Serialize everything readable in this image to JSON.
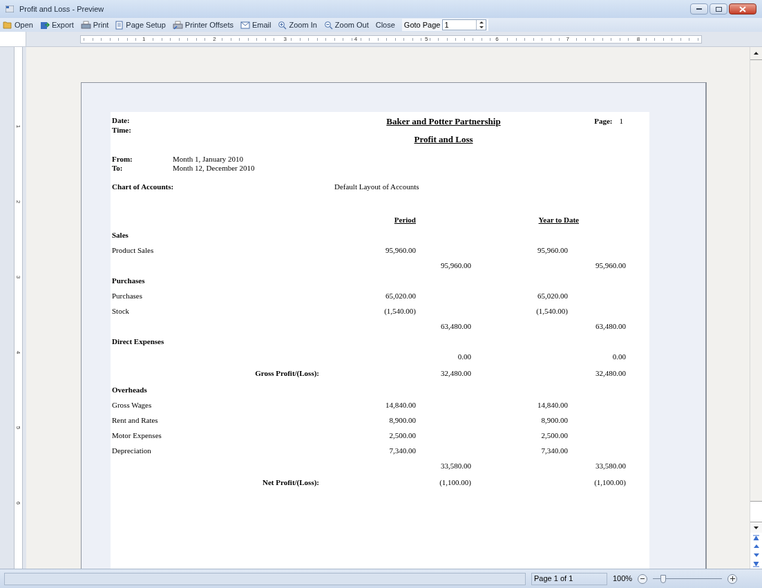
{
  "window": {
    "title": "Profit and Loss - Preview"
  },
  "toolbar": [
    {
      "kind": "open",
      "label": "Open"
    },
    {
      "kind": "export",
      "label": "Export"
    },
    {
      "kind": "print",
      "label": "Print"
    },
    {
      "kind": "page-setup",
      "label": "Page Setup"
    },
    {
      "kind": "offsets",
      "label": "Printer Offsets"
    },
    {
      "kind": "email",
      "label": "Email"
    },
    {
      "kind": "zoom-in",
      "label": "Zoom In"
    },
    {
      "kind": "zoom-out",
      "label": "Zoom Out"
    },
    {
      "kind": "plain",
      "label": "Close"
    }
  ],
  "goto_page": {
    "label": "Goto Page",
    "value": "1"
  },
  "ruler": {
    "horizontal": [
      "1",
      "2",
      "3",
      "4",
      "5",
      "6",
      "7",
      "8"
    ],
    "vertical": [
      "1",
      "2",
      "3",
      "4",
      "5",
      "6"
    ]
  },
  "report": {
    "date_label": "Date:",
    "time_label": "Time:",
    "page_label": "Page:",
    "page_number": "1",
    "company": "Baker and Potter Partnership",
    "title": "Profit and Loss",
    "from_label": "From:",
    "from_value": "Month 1, January 2010",
    "to_label": "To:",
    "to_value": "Month 12, December 2010",
    "chart_label": "Chart of Accounts:",
    "chart_value": "Default Layout of Accounts",
    "col_period": "Period",
    "col_ytd": "Year to Date",
    "rows": [
      {
        "kind": "section",
        "label": "Sales"
      },
      {
        "kind": "item",
        "label": "Product Sales",
        "period": "95,960.00",
        "ytd": "95,960.00"
      },
      {
        "kind": "subtotal",
        "period": "95,960.00",
        "ytd": "95,960.00"
      },
      {
        "kind": "section",
        "label": "Purchases"
      },
      {
        "kind": "item",
        "label": "Purchases",
        "period": "65,020.00",
        "ytd": "65,020.00"
      },
      {
        "kind": "item",
        "label": "Stock",
        "period": "(1,540.00)",
        "ytd": "(1,540.00)"
      },
      {
        "kind": "subtotal",
        "period": "63,480.00",
        "ytd": "63,480.00"
      },
      {
        "kind": "section",
        "label": "Direct Expenses"
      },
      {
        "kind": "subtotal",
        "period": "0.00",
        "ytd": "0.00"
      },
      {
        "kind": "total",
        "label": "Gross Profit/(Loss):",
        "period": "32,480.00",
        "ytd": "32,480.00"
      },
      {
        "kind": "section",
        "label": "Overheads"
      },
      {
        "kind": "item",
        "label": "Gross Wages",
        "period": "14,840.00",
        "ytd": "14,840.00"
      },
      {
        "kind": "item",
        "label": "Rent and Rates",
        "period": "8,900.00",
        "ytd": "8,900.00"
      },
      {
        "kind": "item",
        "label": "Motor Expenses",
        "period": "2,500.00",
        "ytd": "2,500.00"
      },
      {
        "kind": "item",
        "label": "Depreciation",
        "period": "7,340.00",
        "ytd": "7,340.00"
      },
      {
        "kind": "subtotal",
        "period": "33,580.00",
        "ytd": "33,580.00"
      },
      {
        "kind": "total",
        "label": "Net Profit/(Loss):",
        "period": "(1,100.00)",
        "ytd": "(1,100.00)"
      }
    ]
  },
  "status_bar": {
    "page": "Page 1 of 1",
    "zoom": "100%",
    "zoom_level": {
      "level": 0.15
    }
  }
}
